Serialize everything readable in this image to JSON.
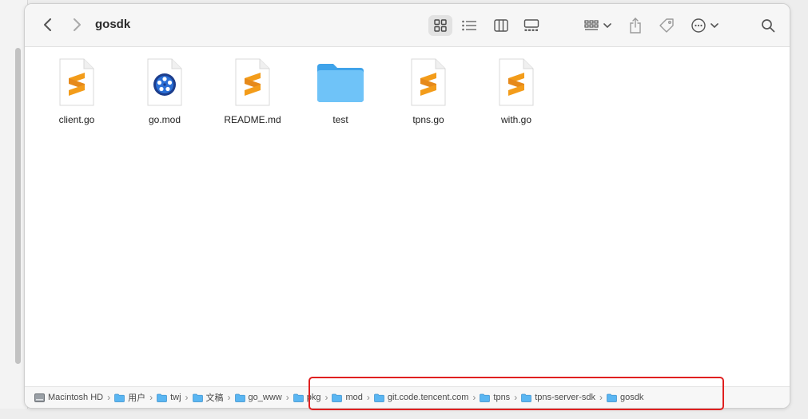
{
  "window": {
    "title": "gosdk"
  },
  "toolbar": {
    "back_icon": "chevron-left-icon",
    "forward_icon": "chevron-right-icon",
    "view_modes": [
      "icon-view",
      "list-view",
      "column-view",
      "gallery-view"
    ],
    "active_view": "icon-view"
  },
  "files": [
    {
      "name": "client.go",
      "type": "sublime-doc"
    },
    {
      "name": "go.mod",
      "type": "quicktime-doc"
    },
    {
      "name": "README.md",
      "type": "sublime-doc"
    },
    {
      "name": "test",
      "type": "folder"
    },
    {
      "name": "tpns.go",
      "type": "sublime-doc"
    },
    {
      "name": "with.go",
      "type": "sublime-doc"
    }
  ],
  "pathbar": {
    "crumbs": [
      {
        "label": "Macintosh HD",
        "icon": "hard-drive-icon"
      },
      {
        "label": "用户",
        "icon": "folder-icon"
      },
      {
        "label": "twj",
        "icon": "folder-icon"
      },
      {
        "label": "文稿",
        "icon": "folder-icon"
      },
      {
        "label": "go_www",
        "icon": "folder-icon"
      },
      {
        "label": "pkg",
        "icon": "folder-icon"
      },
      {
        "label": "mod",
        "icon": "folder-icon"
      },
      {
        "label": "git.code.tencent.com",
        "icon": "folder-icon"
      },
      {
        "label": "tpns",
        "icon": "folder-icon"
      },
      {
        "label": "tpns-server-sdk",
        "icon": "folder-icon"
      },
      {
        "label": "gosdk",
        "icon": "folder-icon"
      }
    ],
    "separator": "›"
  },
  "colors": {
    "accent_folder": "#5ab6f2",
    "sublime_orange": "#f39c1a",
    "highlight_box": "#e02020"
  }
}
